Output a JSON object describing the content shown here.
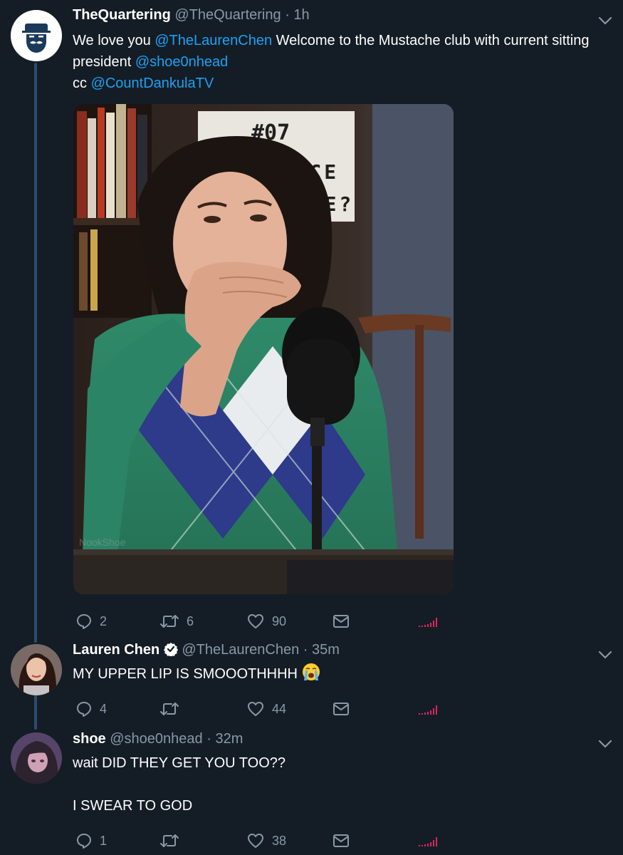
{
  "tweets": [
    {
      "name": "TheQuartering",
      "handle": "@TheQuartering",
      "sep": "·",
      "time": "1h",
      "text_1": "We love you ",
      "mention_1": "@TheLaurenChen",
      "text_2": " Welcome to the Mustache club with current sitting president ",
      "mention_2": "@shoe0nhead",
      "text_3": "cc ",
      "mention_3": "@CountDankulaTV",
      "media": {
        "sign_line1": "#07",
        "sign_line2": "USTICE",
        "sign_line3": "SSIE?",
        "watermark": "NookShoe"
      },
      "replies": "2",
      "retweets": "6",
      "likes": "90"
    },
    {
      "name": "Lauren Chen",
      "handle": "@TheLaurenChen",
      "sep": "·",
      "time": "35m",
      "text": "MY UPPER LIP IS SMOOOTHHHH",
      "emoji": "loudly-crying-face",
      "replies": "4",
      "retweets": "",
      "likes": "44"
    },
    {
      "name": "shoe",
      "handle": "@shoe0nhead",
      "sep": "·",
      "time": "32m",
      "text_1": "wait DID THEY GET YOU TOO??",
      "text_2": "I SWEAR TO GOD",
      "replies": "1",
      "retweets": "",
      "likes": "38"
    }
  ],
  "colors": {
    "background": "#141d26",
    "link": "#1da1f2",
    "muted": "#8899a6",
    "thread_line": "#2a4d6e",
    "analytics": "#e0245e"
  }
}
